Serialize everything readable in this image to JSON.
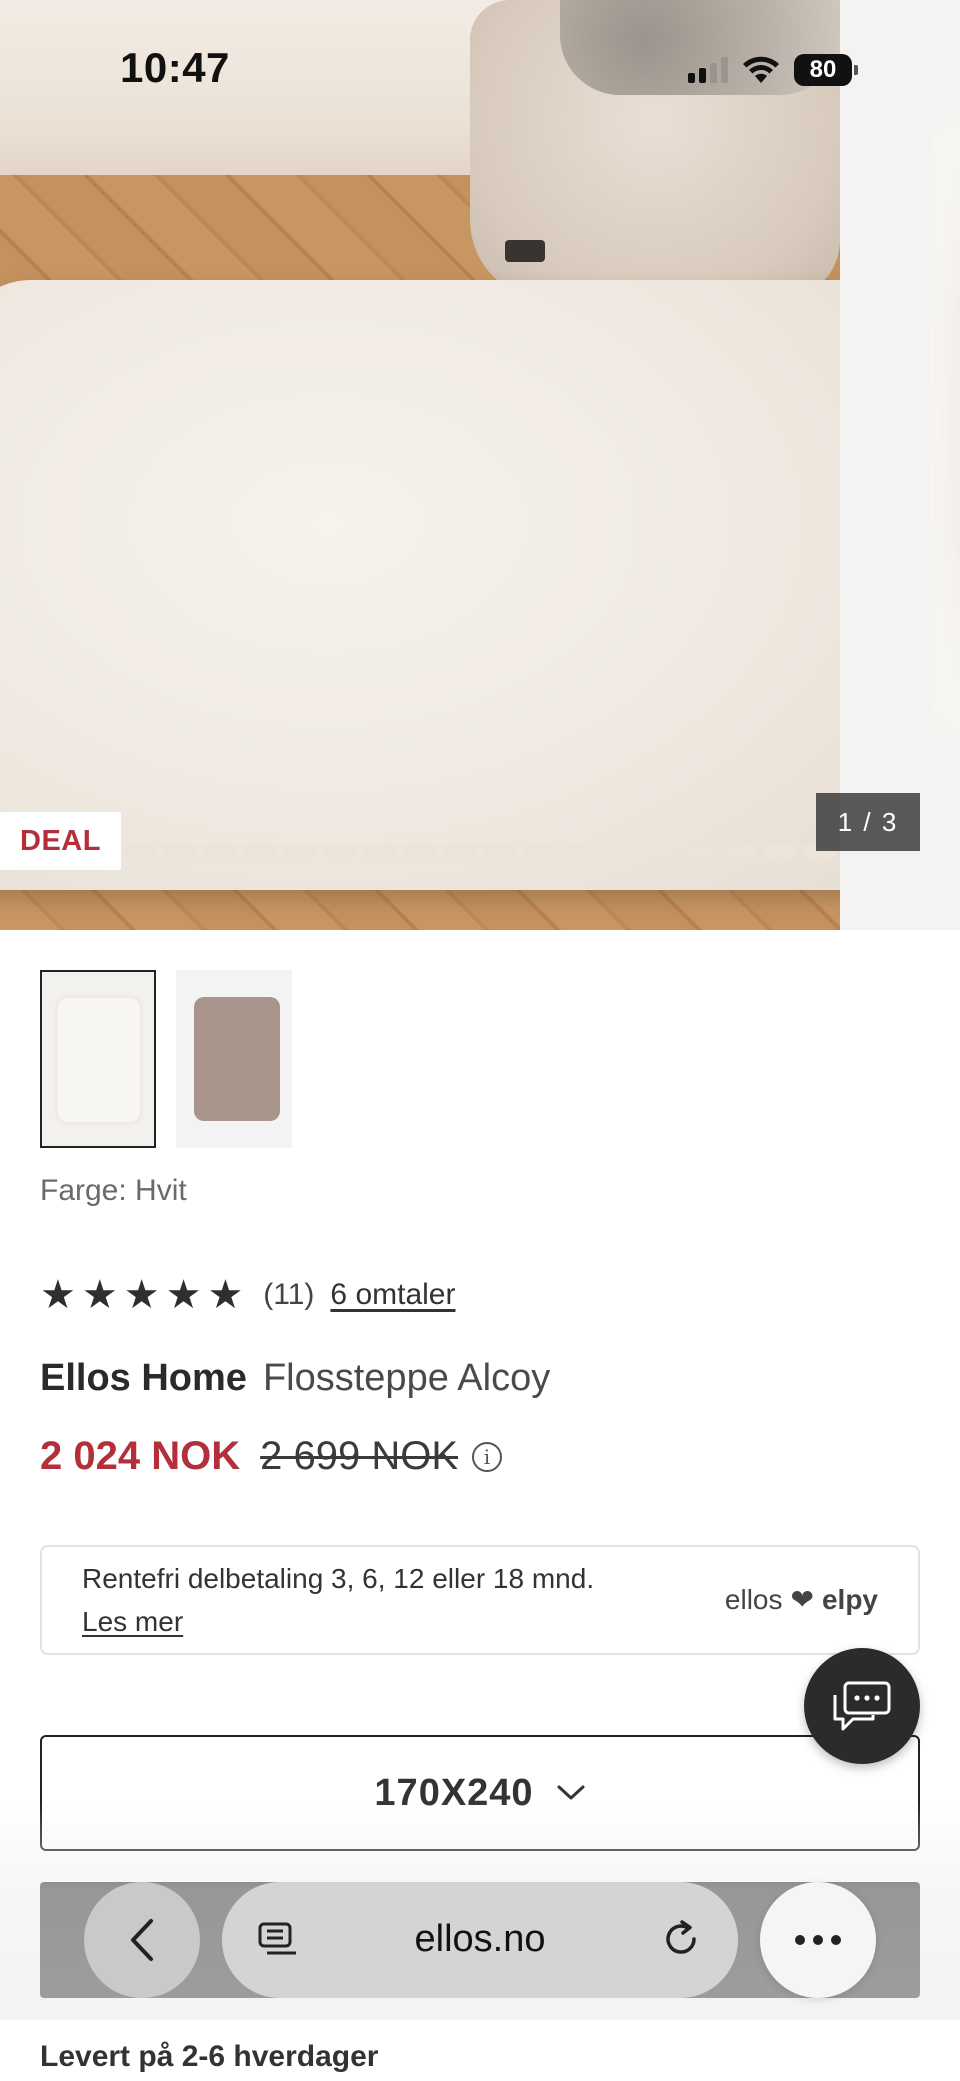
{
  "status_bar": {
    "time": "10:47",
    "battery": "80"
  },
  "gallery": {
    "badge": "DEAL",
    "counter": "1 / 3"
  },
  "thumbnails": [
    {
      "color": "Hvit",
      "selected": true
    },
    {
      "color": "brown",
      "selected": false
    }
  ],
  "color_label": "Farge: Hvit",
  "rating": {
    "stars": 5,
    "count": "(11)",
    "reviews_link": "6 omtaler"
  },
  "product": {
    "brand": "Ellos Home",
    "name": "Flossteppe Alcoy"
  },
  "price": {
    "current": "2 024 NOK",
    "original": "2 699 NOK"
  },
  "installment": {
    "text": "Rentefri delbetaling 3, 6, 12 eller 18 mnd.",
    "link": "Les mer",
    "partner_left": "ellos",
    "partner_right": "elpy"
  },
  "size_select": {
    "value": "170X240"
  },
  "browser": {
    "url": "ellos.no"
  },
  "delivery": "Levert på 2-6 hverdager",
  "colors": {
    "sale_red": "#b3303b",
    "dark": "#2a2a2a"
  }
}
